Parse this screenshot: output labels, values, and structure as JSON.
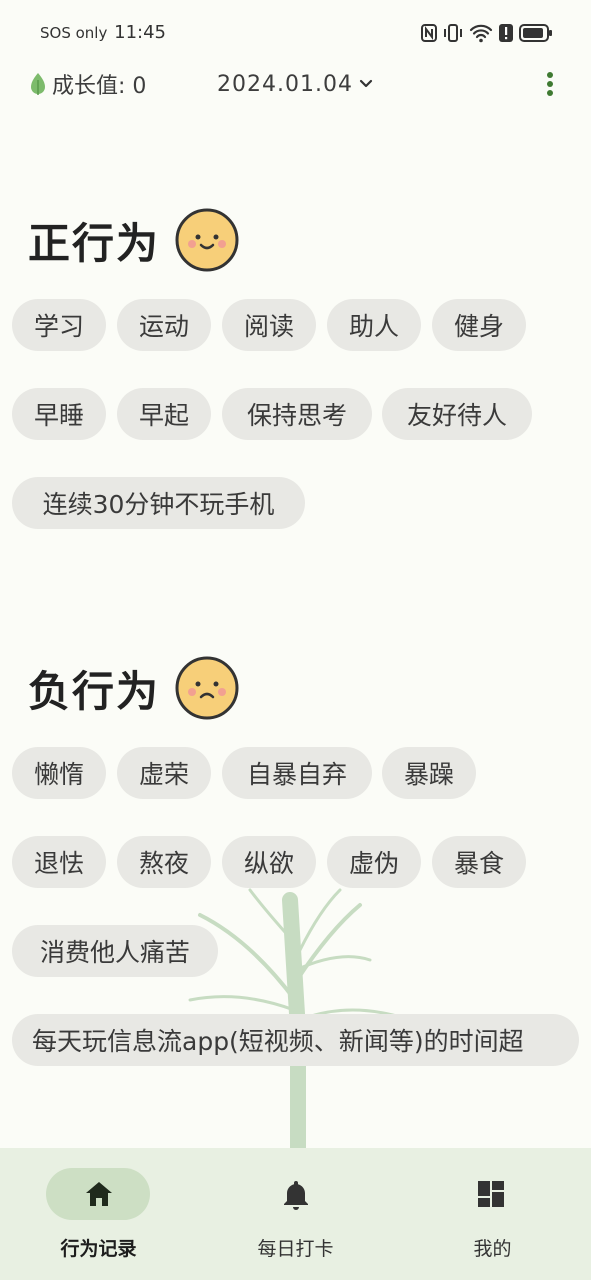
{
  "status_bar": {
    "carrier": "SOS only",
    "time": "11:45"
  },
  "header": {
    "growth_label": "成长值: 0",
    "date": "2024.01.04",
    "date_icon": "chevron-down-icon",
    "menu_icon": "more-vertical-icon"
  },
  "positive": {
    "title": "正行为",
    "face_icon": "smile-face-icon",
    "chips": [
      "学习",
      "运动",
      "阅读",
      "助人",
      "健身",
      "早睡",
      "早起",
      "保持思考",
      "友好待人",
      "连续30分钟不玩手机"
    ]
  },
  "negative": {
    "title": "负行为",
    "face_icon": "sad-face-icon",
    "chips": [
      "懒惰",
      "虚荣",
      "自暴自弃",
      "暴躁",
      "退怯",
      "熬夜",
      "纵欲",
      "虚伪",
      "暴食",
      "消费他人痛苦",
      "每天玩信息流app(短视频、新闻等)的时间超"
    ]
  },
  "nav": {
    "items": [
      {
        "label": "行为记录",
        "icon": "home-icon"
      },
      {
        "label": "每日打卡",
        "icon": "bell-icon"
      },
      {
        "label": "我的",
        "icon": "dashboard-icon"
      }
    ]
  },
  "colors": {
    "background": "#fbfcf7",
    "chip": "#e8e8e4",
    "nav_bg": "#e8f0e2",
    "nav_active": "#cddfc4",
    "leaf": "#7dbb6c",
    "face": "#f7cf79"
  }
}
